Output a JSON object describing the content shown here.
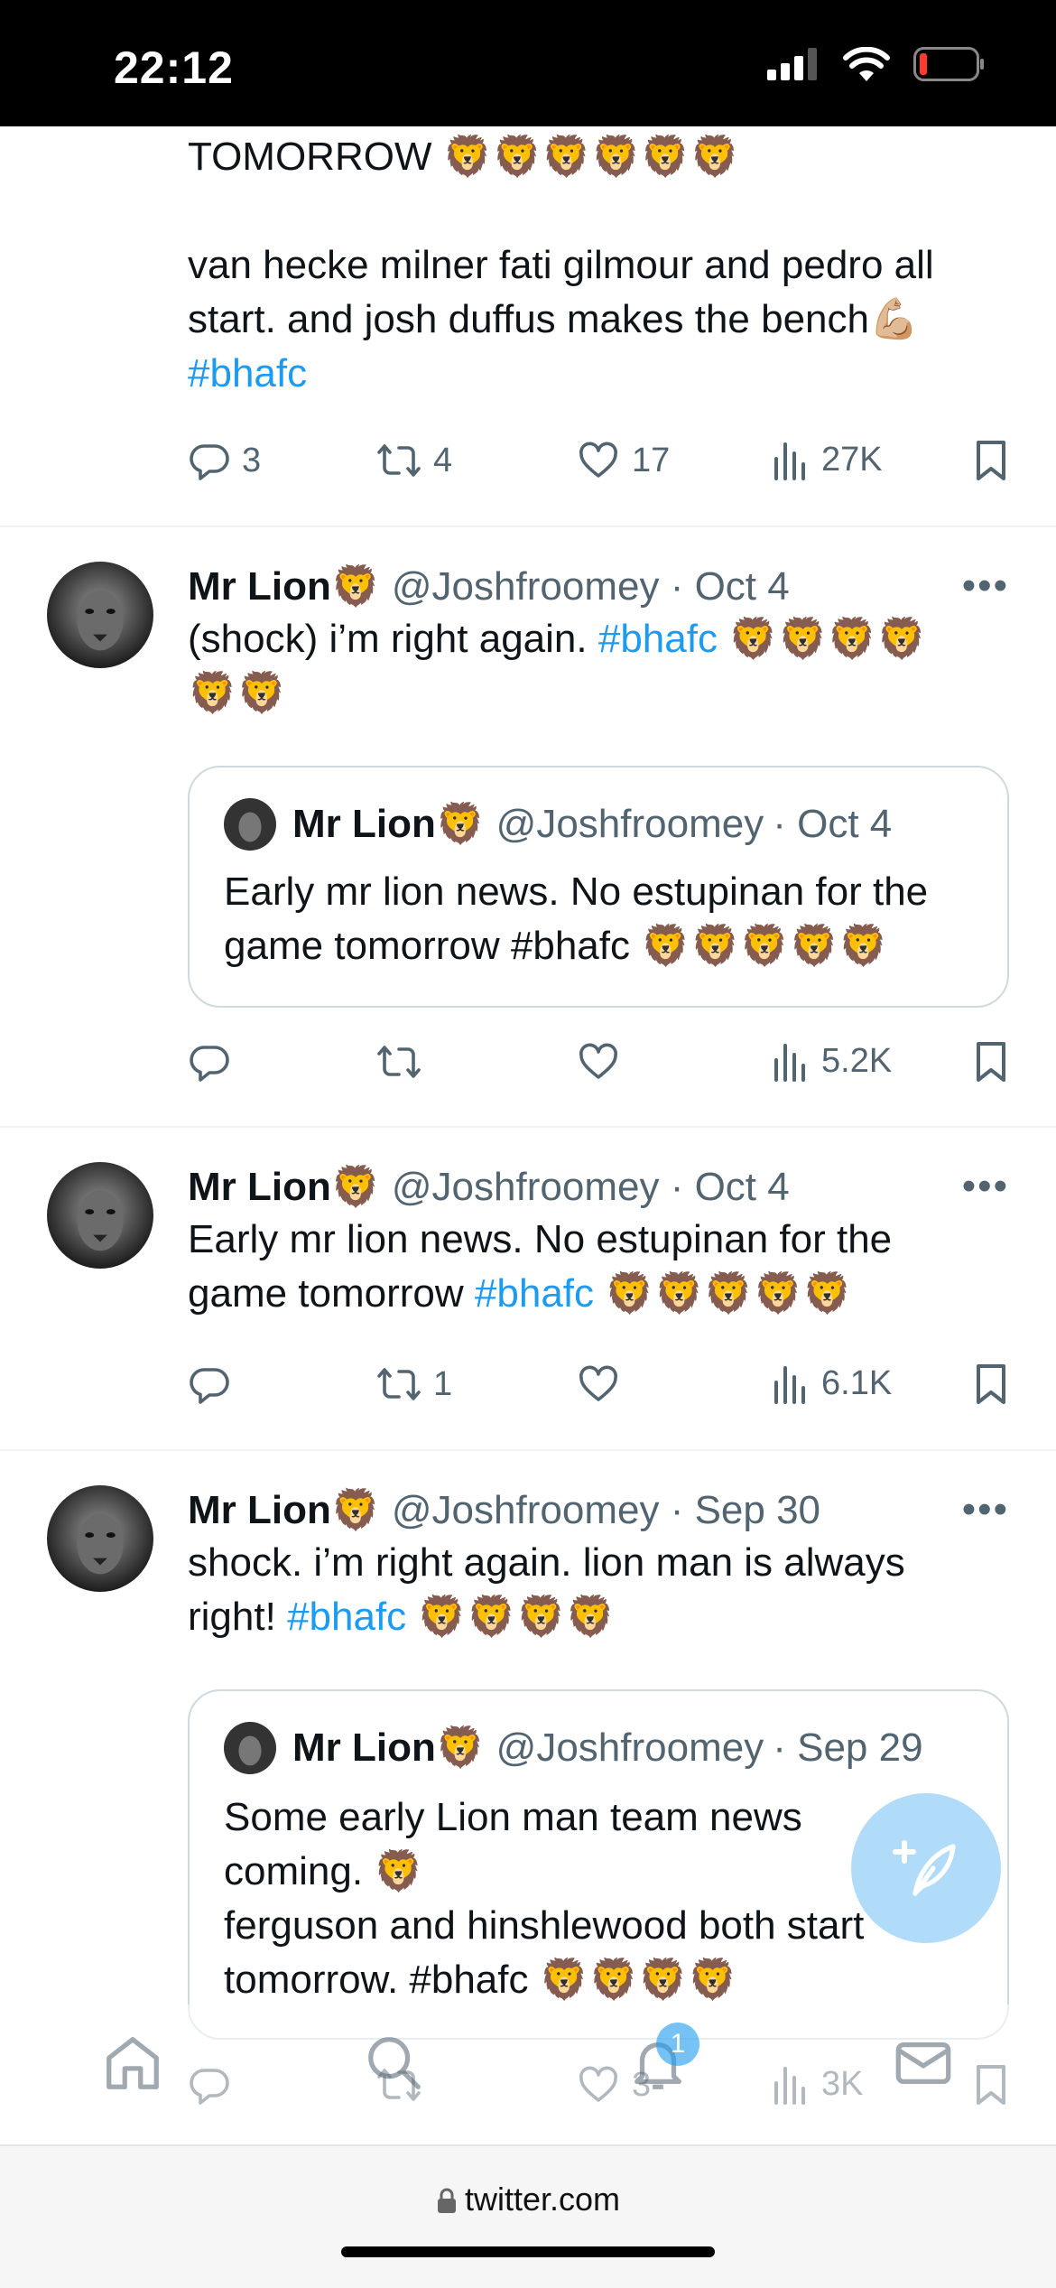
{
  "status_bar": {
    "time": "22:12"
  },
  "top_tweet": {
    "line1": "TOMORROW",
    "line1_emoji": "🦁🦁🦁🦁🦁🦁",
    "line2": "van hecke milner fati gilmour and pedro all",
    "line3": "start. and josh duffus makes the bench",
    "line3_emoji": "💪🏼",
    "hashtag": "#bhafc",
    "replies": "3",
    "retweets": "4",
    "likes": "17",
    "views": "27K"
  },
  "tweets": [
    {
      "name": "Mr Lion",
      "name_emoji": "🦁",
      "handle": "@Joshfroomey",
      "date": "· Oct 4",
      "text_a": "(shock) i’m right again.",
      "hashtag": "#bhafc",
      "emoji_a": "🦁🦁🦁🦁",
      "emoji_b": "🦁🦁",
      "quote": {
        "name": "Mr Lion",
        "name_emoji": "🦁",
        "handle": "@Joshfroomey",
        "date": "· Oct 4",
        "line1": "Early mr lion news. No estupinan for the",
        "line2": "game tomorrow #bhafc",
        "line2_emoji": "🦁🦁🦁🦁🦁"
      },
      "views": "5.2K"
    },
    {
      "name": "Mr Lion",
      "name_emoji": "🦁",
      "handle": "@Joshfroomey",
      "date": "· Oct 4",
      "line1": "Early mr lion news. No estupinan for the",
      "line2": "game tomorrow",
      "hashtag": "#bhafc",
      "emoji": "🦁🦁🦁🦁🦁",
      "retweets": "1",
      "views": "6.1K"
    },
    {
      "name": "Mr Lion",
      "name_emoji": "🦁",
      "handle": "@Joshfroomey",
      "date": "· Sep 30",
      "line1": "shock. i’m right again. lion man is always",
      "line2": "right!",
      "hashtag": "#bhafc",
      "emoji": "🦁🦁🦁🦁",
      "quote": {
        "name": "Mr Lion",
        "name_emoji": "🦁",
        "handle": "@Joshfroomey",
        "date": "· Sep 29",
        "line1": "Some early Lion man team news",
        "line2": "coming.",
        "line2_emoji": "🦁",
        "line3": "ferguson and hinshlewood both start",
        "line4": "tomorrow. #bhafc",
        "line4_emoji": "🦁🦁🦁🦁"
      },
      "likes": "3",
      "views": "3K"
    }
  ],
  "tab_bar": {
    "notification_badge": "1"
  },
  "browser": {
    "url": "twitter.com"
  },
  "colors": {
    "accent": "#1d9bf0",
    "muted": "#536471",
    "text": "#0f1419"
  },
  "icons": [
    "reply-icon",
    "retweet-icon",
    "like-icon",
    "views-icon",
    "bookmark-icon",
    "more-icon",
    "home-icon",
    "search-icon",
    "notifications-icon",
    "messages-icon",
    "compose-icon",
    "lock-icon"
  ]
}
